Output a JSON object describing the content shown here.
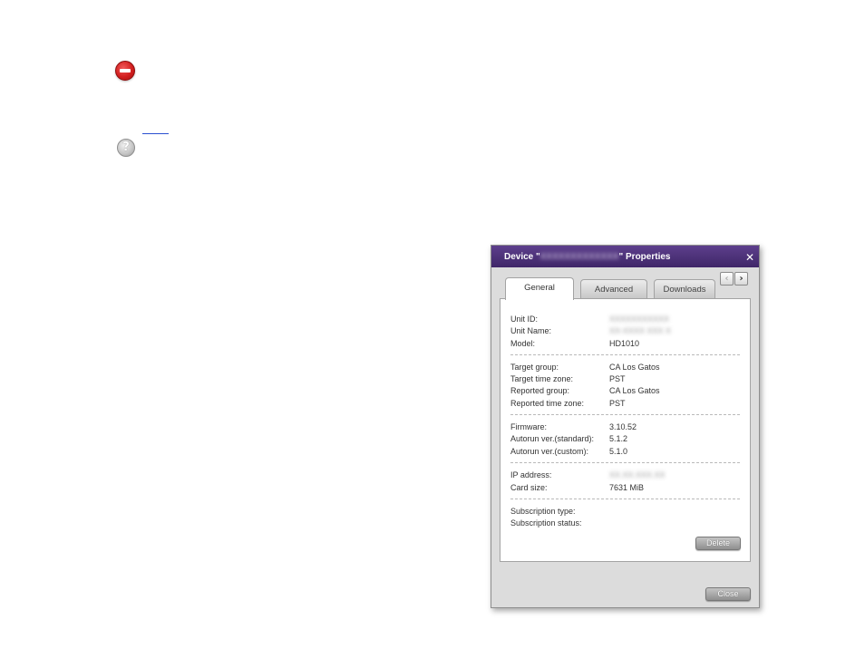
{
  "page": {
    "error_icon": "stop-icon",
    "help_icon": "question-icon",
    "help_glyph": "?"
  },
  "dialog": {
    "title_prefix": "Device \"",
    "title_device_blurred": "XXXXXXXXXXXXX",
    "title_suffix": "\" Properties",
    "close_glyph": "✕",
    "scroll_left_glyph": "‹",
    "scroll_right_glyph": "›",
    "tabs": [
      {
        "label": "General",
        "active": true
      },
      {
        "label": "Advanced",
        "active": false
      },
      {
        "label": "Downloads",
        "active": false
      }
    ],
    "general": {
      "unit_id_label": "Unit ID:",
      "unit_id_value": "XXXXXXXXXXX",
      "unit_name_label": "Unit Name:",
      "unit_name_value": "XX-XXXX XXX X",
      "model_label": "Model:",
      "model_value": "HD1010",
      "target_group_label": "Target group:",
      "target_group_value": "CA Los Gatos",
      "target_tz_label": "Target time zone:",
      "target_tz_value": "PST",
      "reported_group_label": "Reported group:",
      "reported_group_value": "CA Los Gatos",
      "reported_tz_label": "Reported time zone:",
      "reported_tz_value": "PST",
      "firmware_label": "Firmware:",
      "firmware_value": "3.10.52",
      "autorun_std_label": "Autorun ver.(standard):",
      "autorun_std_value": "5.1.2",
      "autorun_custom_label": "Autorun ver.(custom):",
      "autorun_custom_value": "5.1.0",
      "ip_label": "IP address:",
      "ip_value": "XX.XX.XXX.XX",
      "card_size_label": "Card size:",
      "card_size_value": "7631 MiB",
      "subscription_type_label": "Subscription type:",
      "subscription_status_label": "Subscription status:"
    },
    "delete_button": "Delete",
    "close_button": "Close"
  }
}
